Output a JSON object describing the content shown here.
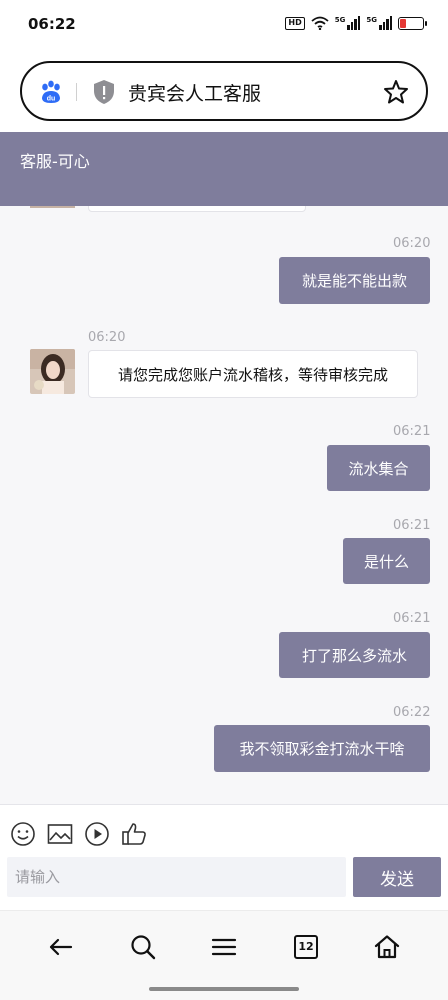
{
  "status_bar": {
    "time": "06:22",
    "hd_label": "HD",
    "network_label_1": "5G",
    "network_label_2": "5G",
    "battery_level": 0.25,
    "battery_color": "#e53935"
  },
  "url_bar": {
    "title": "贵宾会人工客服",
    "left_icon": "baidu-paw-icon",
    "security_icon": "shield-icon",
    "right_icon": "star-icon"
  },
  "chat_header": {
    "title": "客服-可心",
    "background_color": "#7f7d9c"
  },
  "messages": [
    {
      "direction": "out",
      "time": "06:20",
      "text": "就是能不能出款"
    },
    {
      "direction": "in",
      "time": "06:20",
      "text": "请您完成您账户流水稽核，等待审核完成"
    },
    {
      "direction": "out",
      "time": "06:21",
      "text": "流水集合"
    },
    {
      "direction": "out",
      "time": "06:21",
      "text": "是什么"
    },
    {
      "direction": "out",
      "time": "06:21",
      "text": "打了那么多流水"
    },
    {
      "direction": "out",
      "time": "06:22",
      "text": "我不领取彩金打流水干啥"
    }
  ],
  "input_area": {
    "tools": [
      "emoji-icon",
      "image-icon",
      "video-icon",
      "thumbs-up-icon"
    ],
    "placeholder": "请输入",
    "send_label": "发送"
  },
  "nav_bar": {
    "items": [
      "back-arrow-icon",
      "search-icon",
      "menu-icon",
      "tabs-icon",
      "home-icon"
    ],
    "tabs_count": "12"
  },
  "colors": {
    "accent": "#7f7d9c",
    "messages_background": "#f7f7f9"
  }
}
